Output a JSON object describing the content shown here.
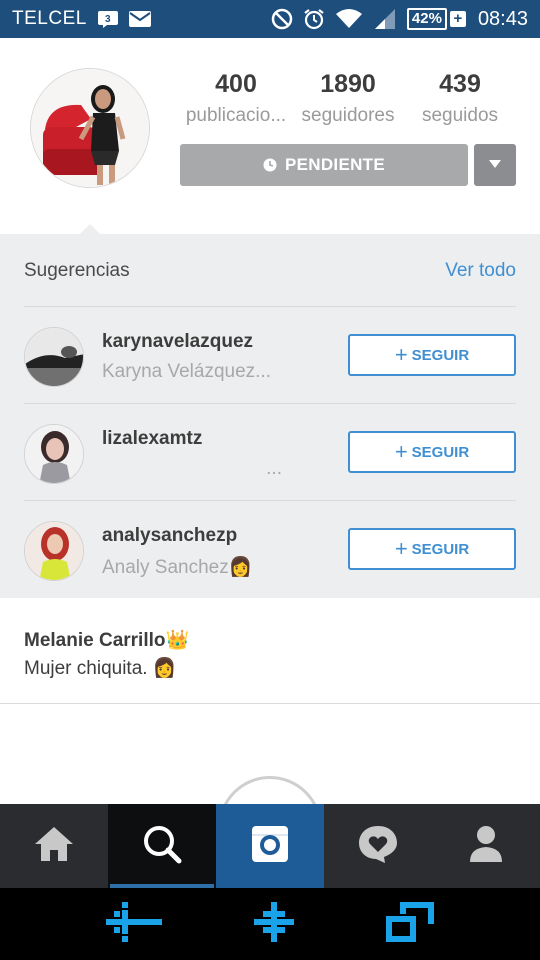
{
  "status_bar": {
    "carrier": "TELCEL",
    "battery_percent": "42%",
    "time": "08:43"
  },
  "profile": {
    "stats": [
      {
        "value": "400",
        "label": "publicacio..."
      },
      {
        "value": "1890",
        "label": "seguidores"
      },
      {
        "value": "439",
        "label": "seguidos"
      }
    ],
    "pending_label": "PENDIENTE"
  },
  "suggestions": {
    "title": "Sugerencias",
    "see_all": "Ver todo",
    "follow_label": "SEGUIR",
    "items": [
      {
        "username": "karynavelazquez",
        "full_name": "Karyna Velázquez..."
      },
      {
        "username": "lizalexamtz",
        "full_name": "..."
      },
      {
        "username": "analysanchezp",
        "full_name": "Analy Sanchez👩"
      }
    ]
  },
  "bio": {
    "name": "Melanie Carrillo👑",
    "text": "Mujer chiquita. 👩"
  },
  "colors": {
    "status_bar": "#1e4e7c",
    "accent_blue": "#3f8fd2",
    "pending_gray": "#a8a9ab",
    "tabbar": "#2a2c2f",
    "camera_tab": "#1e5c98"
  },
  "icons": [
    "no-disturb-icon",
    "alarm-icon",
    "wifi-icon",
    "signal-icon",
    "battery-icon",
    "home-icon",
    "search-icon",
    "camera-icon",
    "activity-icon",
    "profile-icon",
    "back-icon",
    "home-nav-icon",
    "recents-icon"
  ]
}
